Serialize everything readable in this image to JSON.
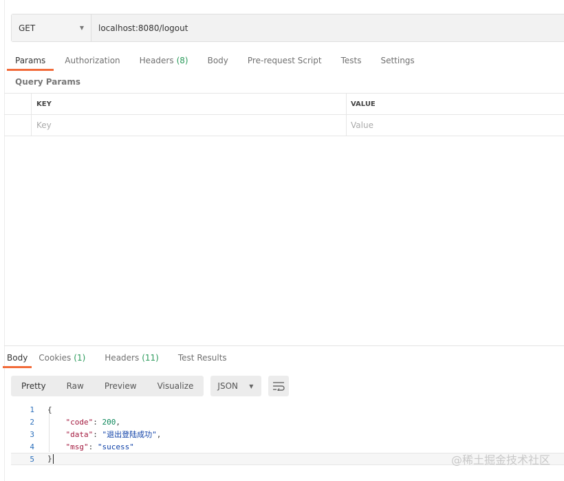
{
  "request": {
    "method": "GET",
    "url": "localhost:8080/logout"
  },
  "request_tabs": [
    {
      "label": "Params",
      "count": ""
    },
    {
      "label": "Authorization",
      "count": ""
    },
    {
      "label": "Headers",
      "count": "(8)"
    },
    {
      "label": "Body",
      "count": ""
    },
    {
      "label": "Pre-request Script",
      "count": ""
    },
    {
      "label": "Tests",
      "count": ""
    },
    {
      "label": "Settings",
      "count": ""
    }
  ],
  "query_params": {
    "title": "Query Params",
    "key_header": "KEY",
    "value_header": "VALUE",
    "key_placeholder": "Key",
    "value_placeholder": "Value"
  },
  "response_tabs": [
    {
      "label": "Body",
      "count": ""
    },
    {
      "label": "Cookies",
      "count": "(1)"
    },
    {
      "label": "Headers",
      "count": "(11)"
    },
    {
      "label": "Test Results",
      "count": ""
    }
  ],
  "response_formats": [
    "Pretty",
    "Raw",
    "Preview",
    "Visualize"
  ],
  "response_language": "JSON",
  "response_lines": [
    {
      "no": "1",
      "indent": "",
      "key": "",
      "sep": "",
      "value": "",
      "vtype": "",
      "tail": "{"
    },
    {
      "no": "2",
      "indent": "    ",
      "key": "\"code\"",
      "sep": ": ",
      "value": "200",
      "vtype": "num",
      "tail": ","
    },
    {
      "no": "3",
      "indent": "    ",
      "key": "\"data\"",
      "sep": ": ",
      "value": "\"退出登陆成功\"",
      "vtype": "str",
      "tail": ","
    },
    {
      "no": "4",
      "indent": "    ",
      "key": "\"msg\"",
      "sep": ": ",
      "value": "\"sucess\"",
      "vtype": "str",
      "tail": ""
    },
    {
      "no": "5",
      "indent": "",
      "key": "",
      "sep": "",
      "value": "",
      "vtype": "",
      "tail": "}"
    }
  ],
  "watermark": "@稀土掘金技术社区",
  "colors": {
    "accent": "#f26b3a",
    "count": "#2a9a5a",
    "json_key": "#a3193e",
    "json_string": "#0b3ea6"
  }
}
